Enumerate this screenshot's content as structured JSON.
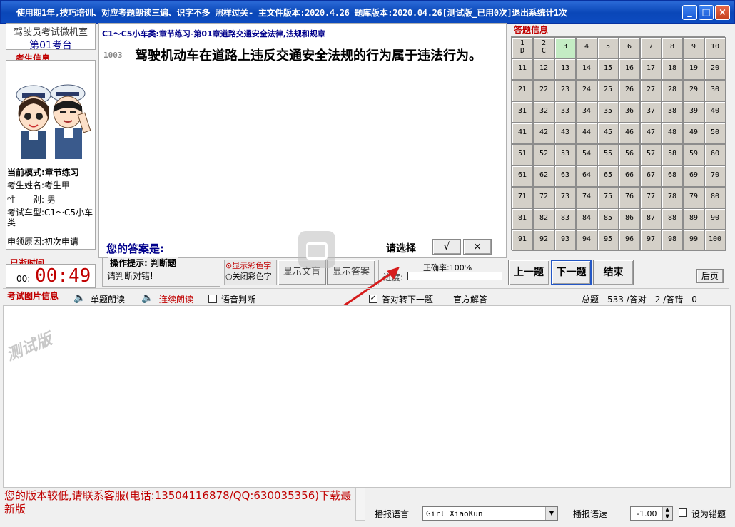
{
  "window": {
    "title": "使用期1年,技巧培训、对应考题朗读三遍、识字不多 照样过关- 主文件版本:2020.4.26 题库版本:2020.04.26[测试版_已用0次]退出系统计1次",
    "min": "_",
    "max": "□",
    "close": "×"
  },
  "sidebar": {
    "room": "驾驶员考试微机室",
    "station": "第01考台",
    "info_title": "考生信息",
    "mode": "当前模式:章节练习",
    "name": "考生姓名:考生甲",
    "gender": "性　　别: 男",
    "vehicle": "考试车型:C1～C5小车类",
    "reason": "申领原因:初次申请",
    "time_title": "已逝时间",
    "time_min": "00:",
    "time_sec": "00:49"
  },
  "question": {
    "category": "C1～C5小车类:章节练习-第01章道路交通安全法律,法规和规章",
    "number": "1003",
    "text": "驾驶机动车在道路上违反交通安全法规的行为属于违法行为。",
    "answer_label": "您的答案是:",
    "choose": "请选择",
    "true_btn": "√",
    "false_btn": "×"
  },
  "hint": {
    "title": "操作提示: 判断题",
    "text": "请判断对错!"
  },
  "tools": {
    "color_on": "⊙显示彩色字",
    "color_off": "○关闭彩色字",
    "show_text": "显示文盲",
    "show_answer": "显示答案",
    "progress_label": "进度:",
    "accuracy": "正确率:100%",
    "progress": 0.0
  },
  "answers": {
    "title": "答题信息",
    "cells": [
      "1\nD",
      "2\nC",
      "3",
      "4",
      "5",
      "6",
      "7",
      "8",
      "9",
      "10",
      "11",
      "12",
      "13",
      "14",
      "15",
      "16",
      "17",
      "18",
      "19",
      "20",
      "21",
      "22",
      "23",
      "24",
      "25",
      "26",
      "27",
      "28",
      "29",
      "30",
      "31",
      "32",
      "33",
      "34",
      "35",
      "36",
      "37",
      "38",
      "39",
      "40",
      "41",
      "42",
      "43",
      "44",
      "45",
      "46",
      "47",
      "48",
      "49",
      "50",
      "51",
      "52",
      "53",
      "54",
      "55",
      "56",
      "57",
      "58",
      "59",
      "60",
      "61",
      "62",
      "63",
      "64",
      "65",
      "66",
      "67",
      "68",
      "69",
      "70",
      "71",
      "72",
      "73",
      "74",
      "75",
      "76",
      "77",
      "78",
      "79",
      "80",
      "81",
      "82",
      "83",
      "84",
      "85",
      "86",
      "87",
      "88",
      "89",
      "90",
      "91",
      "92",
      "93",
      "94",
      "95",
      "96",
      "97",
      "98",
      "99",
      "100"
    ],
    "prev": "上一题",
    "next": "下一题",
    "end": "结束",
    "back": "后页"
  },
  "bar": {
    "pic_title": "考试图片信息",
    "read_single": "单题朗读",
    "read_cont": "连续朗读",
    "voice_judge": "语音判断",
    "auto_next": "答对转下一题",
    "official": "官方解答",
    "total": "总题　533 /答对　2 /答错　0"
  },
  "watermark": "测试版",
  "footer": {
    "notice": "您的版本较低,请联系客服(电话:13504116878/QQ:630035356)下载最新版",
    "lang_label": "播报语言",
    "lang_value": "Girl XiaoKun",
    "speed_label": "播报语速",
    "speed_value": "-1.00",
    "wrong_label": "设为错题"
  },
  "colors": {
    "accent_red": "#c00000",
    "title_blue": "#0d4bc0",
    "current_cell": "#c4ecc4"
  }
}
